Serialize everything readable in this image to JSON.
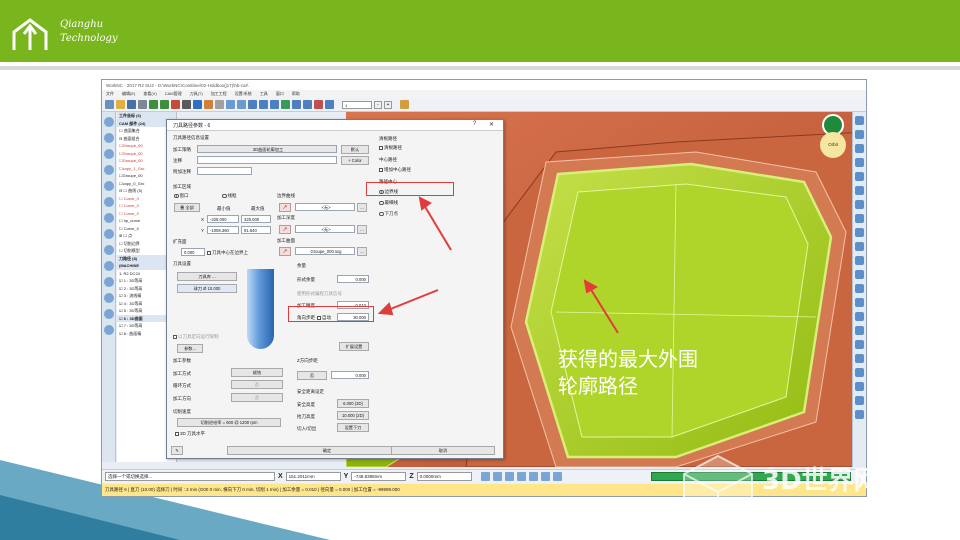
{
  "colors": {
    "banner": "#79b51c",
    "part_orange": "#c45e3c",
    "pocket_green": "#a9cf1e",
    "arrow_red": "#e23b3b",
    "status_yellow": "#ffe68a",
    "progress_green": "#2fa84f"
  },
  "brand": {
    "logo_icon": "house-arrow-icon",
    "line1": "Qianghu",
    "line2": "Technology"
  },
  "app": {
    "title": "WorkNC · 2017 R2 SU2 - D:\\WorkNC\\Combine\\02-Holdbox(j17)\\hb-car\\",
    "menu": [
      "文件",
      "编辑(E)",
      "查看(V)",
      "CAM管理",
      "刀具(T)",
      "加工工程",
      "设置/系统",
      "工具",
      "窗口",
      "帮助"
    ],
    "toolbar_select": "1",
    "tree": [
      {
        "text": "工件坐标 (6)",
        "style": "hdr"
      },
      {
        "text": "CAM 部件 (24)",
        "style": "hdr"
      },
      {
        "text": "☐ 曲面集合",
        "style": ""
      },
      {
        "text": "⊟ 曲面组合",
        "style": ""
      },
      {
        "text": "☐Groupe_00",
        "style": "red"
      },
      {
        "text": "☐Groupe_00",
        "style": "red"
      },
      {
        "text": "☐Groupe_00",
        "style": "red"
      },
      {
        "text": "☐copy_1_Gro",
        "style": "red"
      },
      {
        "text": "☐Groupe_00",
        "style": ""
      },
      {
        "text": "☐copy_0_Gro",
        "style": ""
      },
      {
        "text": "⊟ ☐ 曲线 (5)",
        "style": ""
      },
      {
        "text": "☐ Curve_0",
        "style": "red"
      },
      {
        "text": "☐ Curve_0",
        "style": "red"
      },
      {
        "text": "☐ Curve_0",
        "style": "red"
      },
      {
        "text": "☐ hp_curve",
        "style": ""
      },
      {
        "text": "☐ Curve_0",
        "style": ""
      },
      {
        "text": "⊞ ☐ 点",
        "style": ""
      },
      {
        "text": "☐ 切削边界",
        "style": ""
      },
      {
        "text": "☐ 切削模型",
        "style": ""
      },
      {
        "text": "刀路径 (8)",
        "style": "hdr"
      },
      {
        "text": "(MACHINE",
        "style": "hdr"
      },
      {
        "text": "1: R2 DC24",
        "style": ""
      },
      {
        "text": "☑ 1 : 3D等高",
        "style": ""
      },
      {
        "text": "☑ 2 : 3D等高",
        "style": ""
      },
      {
        "text": "☑ 3 : 流线精",
        "style": ""
      },
      {
        "text": "☑ 4 : 3D等高",
        "style": ""
      },
      {
        "text": "☑ 5 : 3D等高",
        "style": ""
      },
      {
        "text": "☑ 6 : 3D曲面",
        "style": "hdr"
      },
      {
        "text": "☑ 7 : 3D等高",
        "style": ""
      },
      {
        "text": "☑ 8 : 曲面精",
        "style": ""
      }
    ],
    "coords": {
      "prompt": "选择一个或切换选择...",
      "x_label": "X",
      "x_value": "151.2011mm",
      "y_label": "Y",
      "y_value": "-748.8398mm",
      "z_label": "Z",
      "z_value": "0.0000mm"
    },
    "status": "刀具路径 6 | 直刀 (10.00) 选择刀 | 时间 : 2 min (G00 0 min, 横向下刀 0 min, 切削 1 min) | 加工余量 = 0.010 | 径向量 = 0.000 | 加工位置 = -99999.000",
    "orbit_label": "Orbit"
  },
  "dialog": {
    "title": "刀具路径参数 - 6",
    "help": "?",
    "close": "✕",
    "section_info": "刀具路径信息设置",
    "proc_label": "加工策略",
    "proc_value": "3D曲面轮廓加工",
    "default_btn": "默认",
    "name_label": "注释",
    "color_btn": "+ Color",
    "note_label": "附加注释",
    "area_title": "加工区域",
    "area_window": "窗口",
    "area_border": "线框",
    "all_btn": "叠 全部",
    "min_label": "最小值",
    "max_label": "最大值",
    "x_label": "X",
    "x_min": "-325.000",
    "x_max": "325.000",
    "y_label": "Y",
    "y_min": "-1008.360",
    "y_max": "91.640",
    "expand_label": "扩充面",
    "expand_value": "0.000",
    "tool_center_chk": "刀具中心在边界上",
    "tool_section": "刀具设置",
    "tool_btn": "刀具库 ...",
    "tool_name": "球刀 Ø 10.000",
    "tool_limit_chk": "以刀具定向运行限制",
    "params_btn": "参数...",
    "boundary_curve": "边界曲线",
    "none1": "<无>",
    "proc_depth": "加工深度",
    "none2": "<无>",
    "proc_surface": "加工曲面",
    "surface_value": "Groupe_000.sxg",
    "dots": "...",
    "margin_title": "余量",
    "margin_label": "形式余量",
    "margin_value": "0.000",
    "margin_note": "使用形式编程刀具信号",
    "tol_label": "加工精度",
    "tol_value": "0.010",
    "angle_label": "角向步距",
    "auto_chk": "自动",
    "angle_value": "30.000",
    "more_btn": "扩展设置",
    "params_title": "加工参数",
    "mode_label": "加工方式",
    "mode_value": "顺铣",
    "loop_label": "循环方式",
    "loop_value": "否",
    "dir_label": "加工方向",
    "dir_value": "否",
    "zstep_title": "Z方向步距",
    "zstep_btn": "否",
    "zstep_value": "0.000",
    "speed_title": "切削速度",
    "speed_btn": "切削进给率 = 600 @ 1200 rpm",
    "fwd_chk": "3D 刀具水平",
    "safe_title": "安全距离设定",
    "safe_h_label": "安全高度",
    "safe_h_value": "6.000 (3D)",
    "lift_label": "抬刀高度",
    "lift_value": "10.000 (2D)",
    "entry_label": "切入/切出",
    "entry_btn": "设置下刀",
    "ok_btn": "确定",
    "cancel_btn": "取消",
    "rpath_title": "清根路径",
    "rpath_chk": "清根路径",
    "center_title": "中心路径",
    "center_chk": "增加中心路径",
    "path_title": "路径中心",
    "opt_outer": "边界线",
    "opt_min": "最细线",
    "opt_down": "下刀点"
  },
  "callout": {
    "line1": "获得的最大外围",
    "line2": "轮廓路径"
  },
  "watermark": {
    "text": "3D世界网",
    "url": "WWW.3DSJW.COM",
    "brand": "HEXAGON"
  }
}
